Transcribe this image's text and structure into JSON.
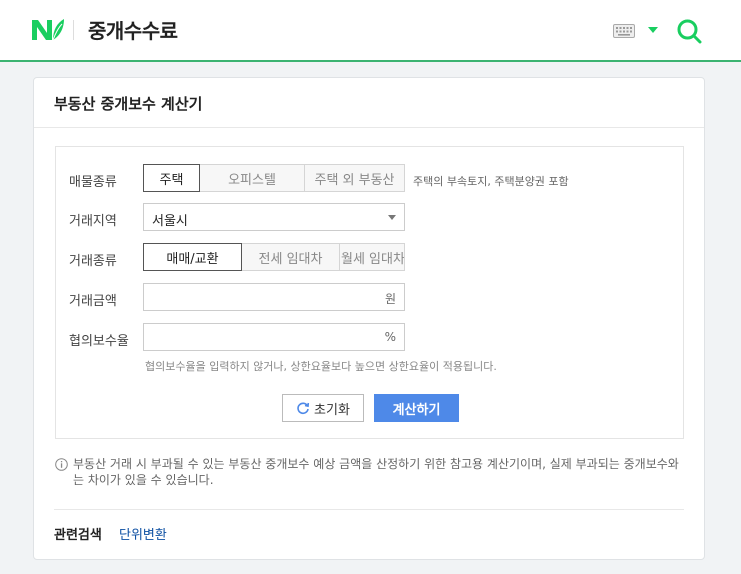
{
  "header": {
    "title": "중개수수료",
    "logo_icon": "naver-n-leaf-logo",
    "keyboard_icon": "keyboard-icon",
    "dropdown_icon": "chevron-down-icon",
    "search_icon": "search-icon",
    "accent_color": "#19ce60"
  },
  "card": {
    "title": "부동산 중개보수 계산기"
  },
  "form": {
    "property_type": {
      "label": "매물종류",
      "options": [
        "주택",
        "오피스텔",
        "주택 외 부동산"
      ],
      "selected": "주택",
      "hint": "주택의 부속토지, 주택분양권 포함"
    },
    "region": {
      "label": "거래지역",
      "value": "서울시"
    },
    "deal_type": {
      "label": "거래종류",
      "options": [
        "매매/교환",
        "전세 임대차",
        "월세 임대차"
      ],
      "selected": "매매/교환"
    },
    "amount": {
      "label": "거래금액",
      "value": "",
      "unit": "원"
    },
    "rate": {
      "label": "협의보수율",
      "value": "",
      "unit": "%",
      "hint": "협의보수율을 입력하지 않거나, 상한요율보다 높으면 상한요율이 적용됩니다."
    },
    "reset_label": "초기화",
    "calc_label": "계산하기",
    "calc_color": "#4e89e8"
  },
  "notice": {
    "text": "부동산 거래 시 부과될 수 있는 부동산 중개보수 예상 금액을 산정하기 위한 참고용 계산기이며, 실제 부과되는 중개보수와는 차이가 있을 수 있습니다."
  },
  "related": {
    "label": "관련검색",
    "link": "단위변환"
  }
}
